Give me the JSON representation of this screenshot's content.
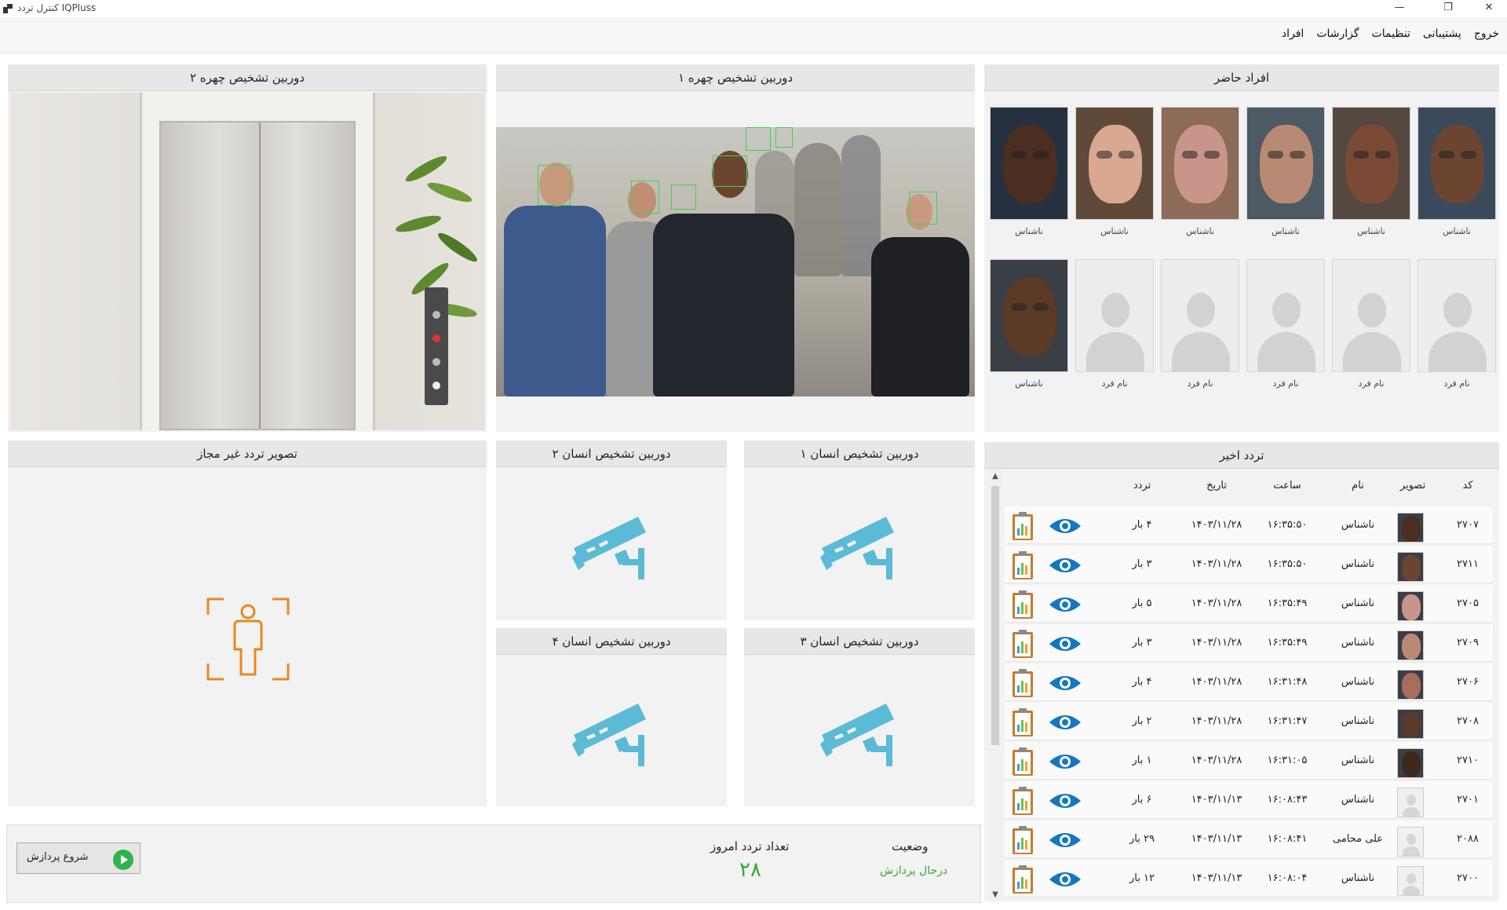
{
  "window": {
    "title": "کنترل تردد IQPluss",
    "controls": {
      "minimize": "—",
      "restore": "❐",
      "close": "✕"
    }
  },
  "menu": {
    "items": [
      "افراد",
      "گزارشات",
      "تنظیمات",
      "پشتیبانی",
      "خروج"
    ]
  },
  "panels": {
    "face_cam_2": "دوربین  تشخیص چهره ۲",
    "face_cam_1": "دوربین  تشخیص چهره ۱",
    "present_people": "افراد حاضر",
    "unauthorized": "تصویر تردد غیر مجاز",
    "human_cam_2": "دوربین تشخیص انسان ۲",
    "human_cam_1": "دوربین تشخیص انسان ۱",
    "human_cam_4": "دوربین تشخیص انسان ۴",
    "human_cam_3": "دوربین تشخیص انسان ۳",
    "recent_traffic": "تردد اخیر"
  },
  "present_people": {
    "row1": [
      {
        "label": "ناشناس",
        "skin": "#6b4530",
        "bg": "#3b4a5a"
      },
      {
        "label": "ناشناس",
        "skin": "#7a4a35",
        "bg": "#544840"
      },
      {
        "label": "ناشناس",
        "skin": "#b98a73",
        "bg": "#4e5a63"
      },
      {
        "label": "ناشناس",
        "skin": "#c9958a",
        "bg": "#8c6b58"
      },
      {
        "label": "ناشناس",
        "skin": "#d8a891",
        "bg": "#5f4a3a"
      },
      {
        "label": "ناشناس",
        "skin": "#4a2e1f",
        "bg": "#26313f"
      }
    ],
    "row2": [
      {
        "label": "نام فرد",
        "placeholder": true
      },
      {
        "label": "نام فرد",
        "placeholder": true
      },
      {
        "label": "نام فرد",
        "placeholder": true
      },
      {
        "label": "نام فرد",
        "placeholder": true
      },
      {
        "label": "نام فرد",
        "placeholder": true
      },
      {
        "label": "ناشناس",
        "skin": "#5b3a26",
        "bg": "#3a3f45"
      }
    ]
  },
  "traffic_table": {
    "headers": {
      "code": "کد",
      "image": "تصویر",
      "name": "نام",
      "time": "ساعت",
      "date": "تاریخ",
      "count": "تردد"
    },
    "rows": [
      {
        "code": "۲۷۰۷",
        "name": "ناشناس",
        "time": "۱۶:۳۵:۵۰",
        "date": "۱۴۰۳/۱۱/۲۸",
        "count": "۴ بار",
        "skin": "#4a2e1f"
      },
      {
        "code": "۲۷۱۱",
        "name": "ناشناس",
        "time": "۱۶:۳۵:۵۰",
        "date": "۱۴۰۳/۱۱/۲۸",
        "count": "۳ بار",
        "skin": "#6b4530"
      },
      {
        "code": "۲۷۰۵",
        "name": "ناشناس",
        "time": "۱۶:۳۵:۴۹",
        "date": "۱۴۰۳/۱۱/۲۸",
        "count": "۵ بار",
        "skin": "#c9958a"
      },
      {
        "code": "۲۷۰۹",
        "name": "ناشناس",
        "time": "۱۶:۳۵:۴۹",
        "date": "۱۴۰۳/۱۱/۲۸",
        "count": "۳ بار",
        "skin": "#b98a73"
      },
      {
        "code": "۲۷۰۶",
        "name": "ناشناس",
        "time": "۱۶:۳۱:۴۸",
        "date": "۱۴۰۳/۱۱/۲۸",
        "count": "۴ بار",
        "skin": "#a86d5c"
      },
      {
        "code": "۲۷۰۸",
        "name": "ناشناس",
        "time": "۱۶:۳۱:۴۷",
        "date": "۱۴۰۳/۱۱/۲۸",
        "count": "۲ بار",
        "skin": "#5a3a2a"
      },
      {
        "code": "۲۷۱۰",
        "name": "ناشناس",
        "time": "۱۶:۳۱:۰۵",
        "date": "۱۴۰۳/۱۱/۲۸",
        "count": "۱ بار",
        "skin": "#3e2a1d"
      },
      {
        "code": "۲۷۰۱",
        "name": "ناشناس",
        "time": "۱۶:۰۸:۴۳",
        "date": "۱۴۰۳/۱۱/۱۳",
        "count": "۶ بار",
        "placeholder": true
      },
      {
        "code": "۲۰۸۸",
        "name": "علی محامی",
        "time": "۱۶:۰۸:۴۱",
        "date": "۱۴۰۳/۱۱/۱۳",
        "count": "۲۹ بار",
        "placeholder": true
      },
      {
        "code": "۲۷۰۰",
        "name": "ناشناس",
        "time": "۱۶:۰۸:۰۴",
        "date": "۱۴۰۳/۱۱/۱۳",
        "count": "۱۲ بار",
        "placeholder": true
      }
    ]
  },
  "status": {
    "start_button": "شروع پردازش",
    "today_count_label": "تعداد تردد امروز",
    "today_count_value": "۲۸",
    "state_label": "وضعیت",
    "state_value": "درحال پردازش"
  },
  "colors": {
    "camera_icon": "#5bbad5",
    "person_icon": "#e8891e",
    "face_box": "#3fd24a",
    "green": "#3aa635",
    "eye": "#1577c1"
  }
}
